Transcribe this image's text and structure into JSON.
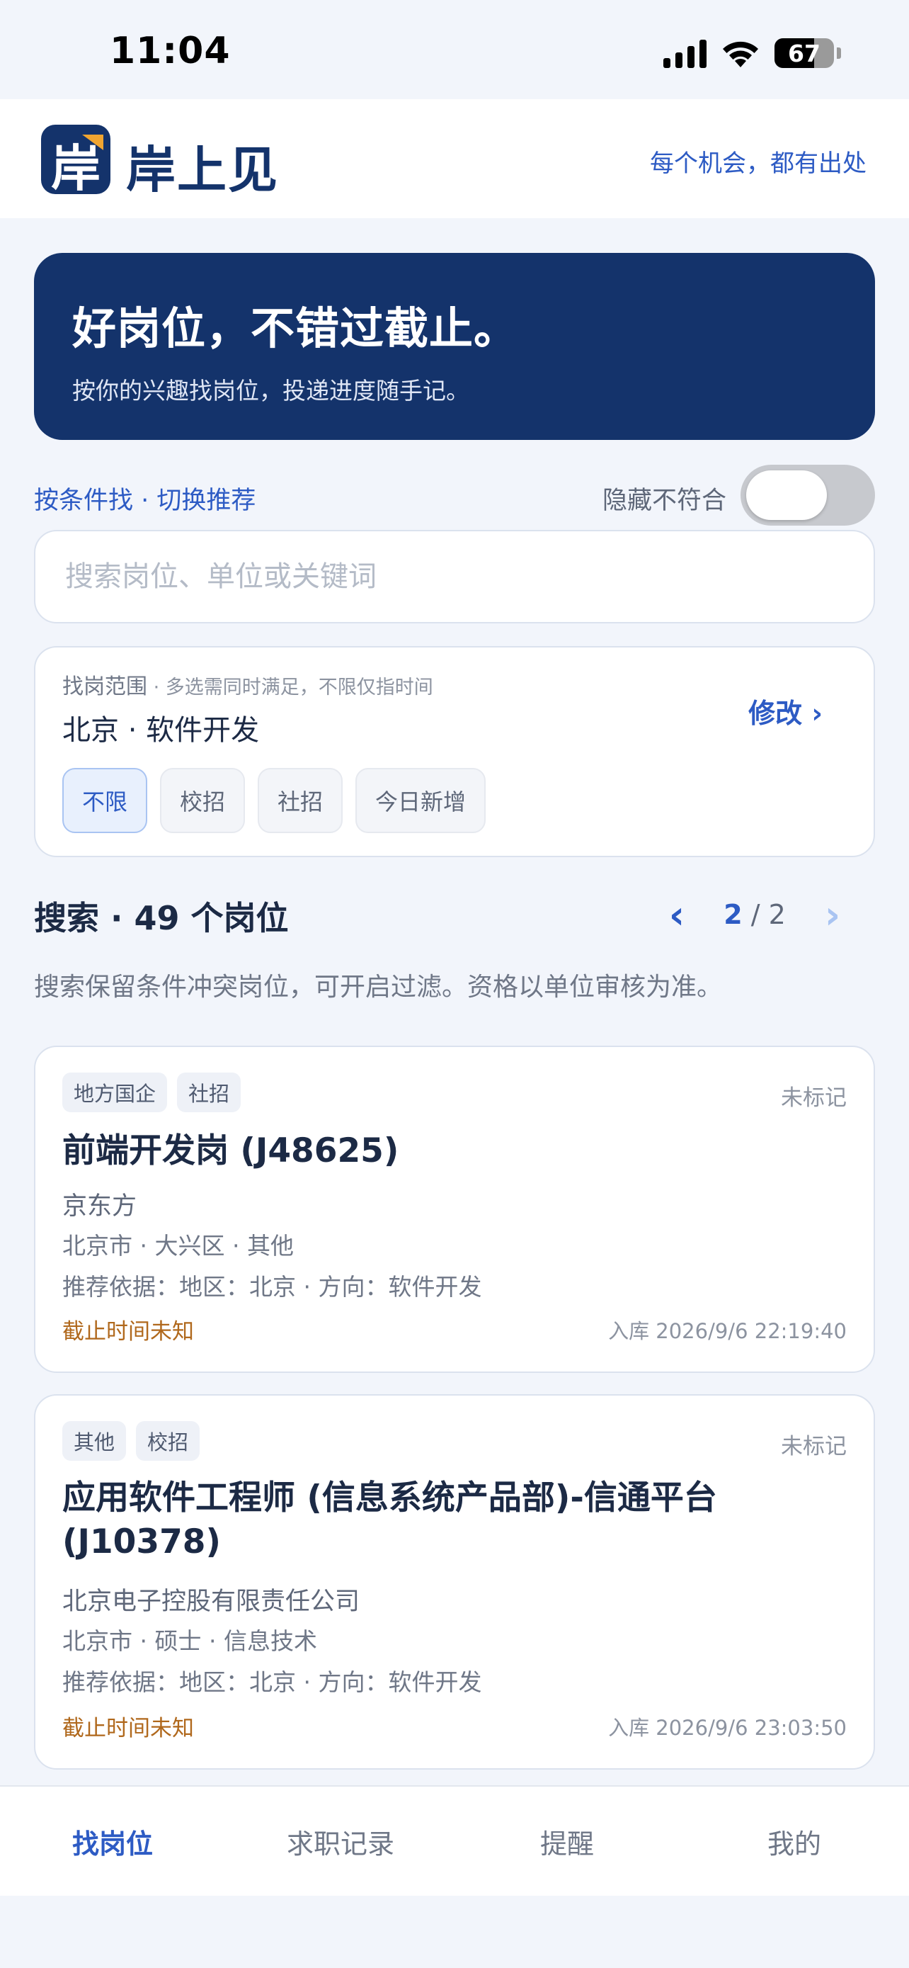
{
  "status_bar": {
    "time": "11:04",
    "battery_percent": 67,
    "battery_label": "67",
    "icons": [
      "signal-icon",
      "wifi-icon",
      "battery-icon"
    ]
  },
  "app": {
    "logo_glyph": "岸",
    "name": "岸上见",
    "slogan": "每个机会，都有出处",
    "brand_color": "#14336b",
    "accent_color": "#2d5bc4"
  },
  "hero": {
    "title": "好岗位，不错过截止。",
    "subtitle": "按你的兴趣找岗位，投递进度随手记。"
  },
  "filter": {
    "links": "按条件找 · 切换推荐",
    "hide_label": "隐藏不符合",
    "hide_enabled": false
  },
  "search": {
    "placeholder": "搜索岗位、单位或关键词",
    "value": ""
  },
  "scope": {
    "label": "找岗范围",
    "hint": " · 多选需同时满足，不限仅指时间",
    "value": "北京 · 软件开发",
    "edit_label": "修改 ›",
    "chips": [
      {
        "label": "不限",
        "active": true
      },
      {
        "label": "校招",
        "active": false
      },
      {
        "label": "社招",
        "active": false
      },
      {
        "label": "今日新增",
        "active": false
      }
    ]
  },
  "results": {
    "title": "搜索 · 49 个岗位",
    "prev_arrow": "‹",
    "next_arrow": "›",
    "current_page": "2",
    "page_separator": " / ",
    "total_pages": "2",
    "note": "搜索保留条件冲突岗位，可开启过滤。资格以单位审核为准。"
  },
  "jobs": [
    {
      "tags": [
        "地方国企",
        "社招"
      ],
      "mark": "未标记",
      "title": "前端开发岗 (J48625)",
      "company": "京东方",
      "location": "北京市 · 大兴区 · 其他",
      "reason": "推荐依据：地区：北京 · 方向：软件开发",
      "deadline": "截止时间未知",
      "added": "入库 2026/9/6 22:19:40"
    },
    {
      "tags": [
        "其他",
        "校招"
      ],
      "mark": "未标记",
      "title": "应用软件工程师 (信息系统产品部)-信通平台 (J10378)",
      "company": "北京电子控股有限责任公司",
      "location": "北京市 · 硕士 · 信息技术",
      "reason": "推荐依据：地区：北京 · 方向：软件开发",
      "deadline": "截止时间未知",
      "added": "入库 2026/9/6 23:03:50"
    }
  ],
  "tabs": [
    {
      "label": "找岗位",
      "active": true
    },
    {
      "label": "求职记录",
      "active": false
    },
    {
      "label": "提醒",
      "active": false
    },
    {
      "label": "我的",
      "active": false
    }
  ]
}
